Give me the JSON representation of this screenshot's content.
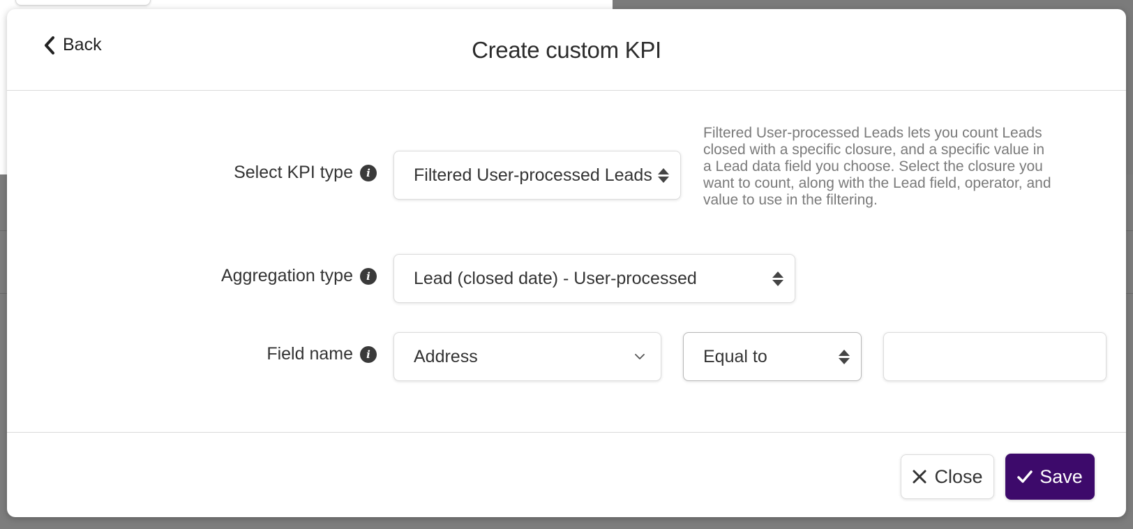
{
  "header": {
    "back_label": "Back",
    "title": "Create custom KPI"
  },
  "form": {
    "kpi_type": {
      "label": "Select KPI type",
      "value": "Filtered User-processed Leads",
      "help": "Filtered User-processed Leads lets you count Leads closed with a specific closure, and a specific value in a Lead data field you choose. Select the closure you want to count, along with the Lead field, operator, and value to use in the filtering."
    },
    "aggregation_type": {
      "label": "Aggregation type",
      "value": "Lead (closed date) - User-processed"
    },
    "field_name": {
      "label": "Field name",
      "field_value": "Address",
      "operator_value": "Equal to",
      "value_input": "",
      "value_placeholder": ""
    }
  },
  "footer": {
    "close_label": "Close",
    "save_label": "Save"
  },
  "colors": {
    "primary": "#3d0a6b",
    "overlay": "#7a7a7a",
    "help_text": "#7a7a7a"
  },
  "icons": {
    "back": "chevron-left-icon",
    "info": "info-icon",
    "select": "sort-updown-icon",
    "dropdown": "chevron-down-icon",
    "close": "x-icon",
    "save": "check-icon"
  }
}
